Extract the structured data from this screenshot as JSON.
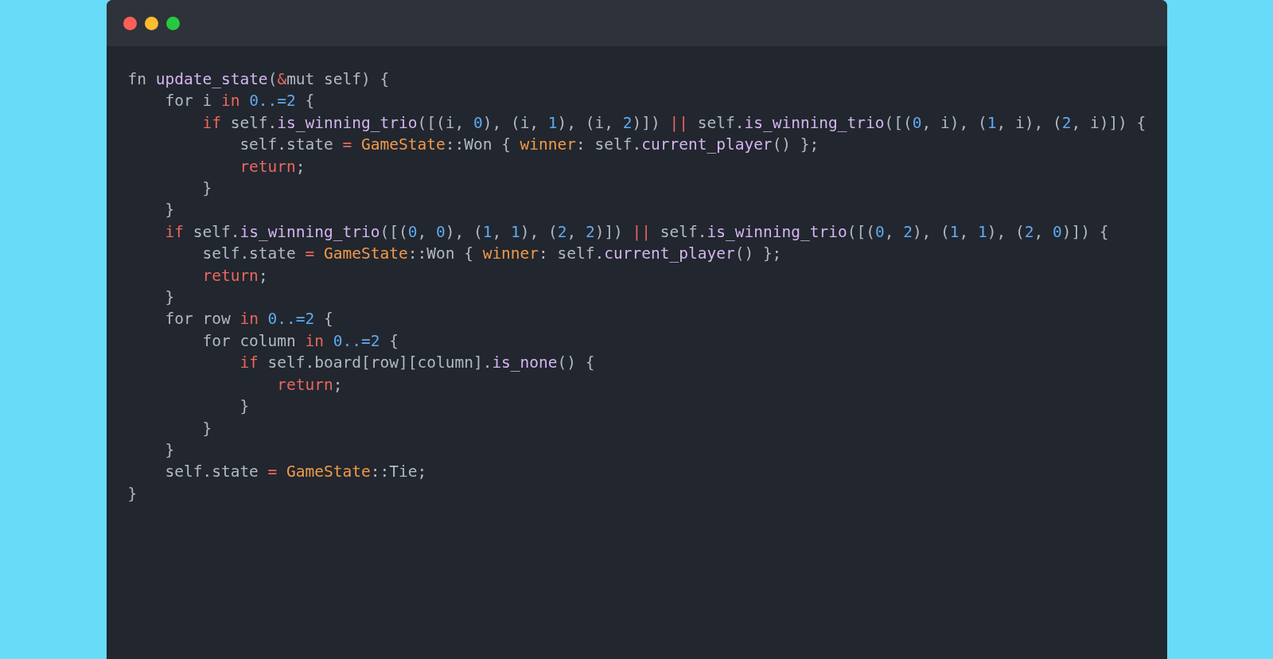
{
  "code": {
    "lines": [
      {
        "tokens": [
          {
            "text": "fn ",
            "kind": "plain"
          },
          {
            "text": "update_state",
            "kind": "function"
          },
          {
            "text": "(",
            "kind": "plain"
          },
          {
            "text": "&",
            "kind": "keyword"
          },
          {
            "text": "mut self) {",
            "kind": "plain"
          }
        ]
      },
      {
        "tokens": [
          {
            "text": "    for i ",
            "kind": "plain"
          },
          {
            "text": "in",
            "kind": "keyword"
          },
          {
            "text": " 0..=2",
            "kind": "number"
          },
          {
            "text": " {",
            "kind": "plain"
          }
        ]
      },
      {
        "tokens": [
          {
            "text": "        if",
            "kind": "keyword"
          },
          {
            "text": " self.",
            "kind": "plain"
          },
          {
            "text": "is_winning_trio",
            "kind": "function"
          },
          {
            "text": "([(i, ",
            "kind": "plain"
          },
          {
            "text": "0",
            "kind": "number"
          },
          {
            "text": "), (i, ",
            "kind": "plain"
          },
          {
            "text": "1",
            "kind": "number"
          },
          {
            "text": "), (i, ",
            "kind": "plain"
          },
          {
            "text": "2",
            "kind": "number"
          },
          {
            "text": ")]) ",
            "kind": "plain"
          },
          {
            "text": "||",
            "kind": "keyword"
          },
          {
            "text": " self.",
            "kind": "plain"
          },
          {
            "text": "is_winning_trio",
            "kind": "function"
          },
          {
            "text": "([(",
            "kind": "plain"
          },
          {
            "text": "0",
            "kind": "number"
          },
          {
            "text": ", i), (",
            "kind": "plain"
          },
          {
            "text": "1",
            "kind": "number"
          },
          {
            "text": ", i), (",
            "kind": "plain"
          },
          {
            "text": "2",
            "kind": "number"
          },
          {
            "text": ", i)]) {",
            "kind": "plain"
          }
        ]
      },
      {
        "tokens": [
          {
            "text": "            self.state ",
            "kind": "plain"
          },
          {
            "text": "=",
            "kind": "keyword"
          },
          {
            "text": " GameState",
            "kind": "type"
          },
          {
            "text": "::Won { ",
            "kind": "plain"
          },
          {
            "text": "winner",
            "kind": "type"
          },
          {
            "text": ": self.",
            "kind": "plain"
          },
          {
            "text": "current_player",
            "kind": "function"
          },
          {
            "text": "() };",
            "kind": "plain"
          }
        ]
      },
      {
        "tokens": [
          {
            "text": "            return",
            "kind": "keyword"
          },
          {
            "text": ";",
            "kind": "plain"
          }
        ]
      },
      {
        "tokens": [
          {
            "text": "        }",
            "kind": "plain"
          }
        ]
      },
      {
        "tokens": [
          {
            "text": "    }",
            "kind": "plain"
          }
        ]
      },
      {
        "tokens": [
          {
            "text": "    if",
            "kind": "keyword"
          },
          {
            "text": " self.",
            "kind": "plain"
          },
          {
            "text": "is_winning_trio",
            "kind": "function"
          },
          {
            "text": "([(",
            "kind": "plain"
          },
          {
            "text": "0",
            "kind": "number"
          },
          {
            "text": ", ",
            "kind": "plain"
          },
          {
            "text": "0",
            "kind": "number"
          },
          {
            "text": "), (",
            "kind": "plain"
          },
          {
            "text": "1",
            "kind": "number"
          },
          {
            "text": ", ",
            "kind": "plain"
          },
          {
            "text": "1",
            "kind": "number"
          },
          {
            "text": "), (",
            "kind": "plain"
          },
          {
            "text": "2",
            "kind": "number"
          },
          {
            "text": ", ",
            "kind": "plain"
          },
          {
            "text": "2",
            "kind": "number"
          },
          {
            "text": ")]) ",
            "kind": "plain"
          },
          {
            "text": "||",
            "kind": "keyword"
          },
          {
            "text": " self.",
            "kind": "plain"
          },
          {
            "text": "is_winning_trio",
            "kind": "function"
          },
          {
            "text": "([(",
            "kind": "plain"
          },
          {
            "text": "0",
            "kind": "number"
          },
          {
            "text": ", ",
            "kind": "plain"
          },
          {
            "text": "2",
            "kind": "number"
          },
          {
            "text": "), (",
            "kind": "plain"
          },
          {
            "text": "1",
            "kind": "number"
          },
          {
            "text": ", ",
            "kind": "plain"
          },
          {
            "text": "1",
            "kind": "number"
          },
          {
            "text": "), (",
            "kind": "plain"
          },
          {
            "text": "2",
            "kind": "number"
          },
          {
            "text": ", ",
            "kind": "plain"
          },
          {
            "text": "0",
            "kind": "number"
          },
          {
            "text": ")]) {",
            "kind": "plain"
          }
        ]
      },
      {
        "tokens": [
          {
            "text": "        self.state ",
            "kind": "plain"
          },
          {
            "text": "=",
            "kind": "keyword"
          },
          {
            "text": " GameState",
            "kind": "type"
          },
          {
            "text": "::Won { ",
            "kind": "plain"
          },
          {
            "text": "winner",
            "kind": "type"
          },
          {
            "text": ": self.",
            "kind": "plain"
          },
          {
            "text": "current_player",
            "kind": "function"
          },
          {
            "text": "() };",
            "kind": "plain"
          }
        ]
      },
      {
        "tokens": [
          {
            "text": "        return",
            "kind": "keyword"
          },
          {
            "text": ";",
            "kind": "plain"
          }
        ]
      },
      {
        "tokens": [
          {
            "text": "    }",
            "kind": "plain"
          }
        ]
      },
      {
        "tokens": [
          {
            "text": "    for row ",
            "kind": "plain"
          },
          {
            "text": "in",
            "kind": "keyword"
          },
          {
            "text": " 0..=2",
            "kind": "number"
          },
          {
            "text": " {",
            "kind": "plain"
          }
        ]
      },
      {
        "tokens": [
          {
            "text": "        for column ",
            "kind": "plain"
          },
          {
            "text": "in",
            "kind": "keyword"
          },
          {
            "text": " 0..=2",
            "kind": "number"
          },
          {
            "text": " {",
            "kind": "plain"
          }
        ]
      },
      {
        "tokens": [
          {
            "text": "            if",
            "kind": "keyword"
          },
          {
            "text": " self.board[row][column].",
            "kind": "plain"
          },
          {
            "text": "is_none",
            "kind": "function"
          },
          {
            "text": "() {",
            "kind": "plain"
          }
        ]
      },
      {
        "tokens": [
          {
            "text": "                return",
            "kind": "keyword"
          },
          {
            "text": ";",
            "kind": "plain"
          }
        ]
      },
      {
        "tokens": [
          {
            "text": "            }",
            "kind": "plain"
          }
        ]
      },
      {
        "tokens": [
          {
            "text": "        }",
            "kind": "plain"
          }
        ]
      },
      {
        "tokens": [
          {
            "text": "    }",
            "kind": "plain"
          }
        ]
      },
      {
        "tokens": [
          {
            "text": "    self.state ",
            "kind": "plain"
          },
          {
            "text": "=",
            "kind": "keyword"
          },
          {
            "text": " GameState",
            "kind": "type"
          },
          {
            "text": "::Tie;",
            "kind": "plain"
          }
        ]
      },
      {
        "tokens": [
          {
            "text": "}",
            "kind": "plain"
          }
        ]
      }
    ]
  }
}
